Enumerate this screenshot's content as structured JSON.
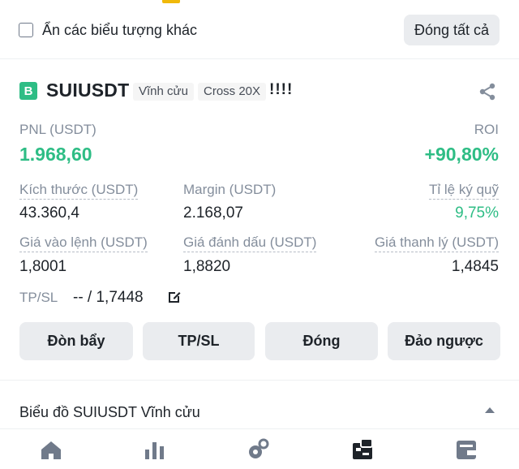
{
  "filter": {
    "hide_label": "Ẩn các biểu tượng khác",
    "close_all_label": "Đóng tất cả"
  },
  "position": {
    "badge": "B",
    "symbol": "SUIUSDT",
    "type_tag": "Vĩnh cửu",
    "margin_tag": "Cross 20X",
    "warning": "!!!!",
    "pnl_label": "PNL (USDT)",
    "pnl_value": "1.968,60",
    "roi_label": "ROI",
    "roi_value": "+90,80%",
    "size_label": "Kích thước (USDT)",
    "size_value": "43.360,4",
    "margin_label": "Margin (USDT)",
    "margin_value": "2.168,07",
    "margin_ratio_label": "Tỉ lệ ký quỹ",
    "margin_ratio_value": "9,75%",
    "entry_label": "Giá vào lệnh (USDT)",
    "entry_value": "1,8001",
    "mark_label": "Giá đánh dấu (USDT)",
    "mark_value": "1,8820",
    "liq_label": "Giá thanh lý (USDT)",
    "liq_value": "1,4845",
    "tpsl_label": "TP/SL",
    "tpsl_value": "-- / 1,7448"
  },
  "actions": {
    "leverage": "Đòn bẩy",
    "tpsl": "TP/SL",
    "close": "Đóng",
    "reverse": "Đảo ngược"
  },
  "chart": {
    "label": "Biểu đồ SUIUSDT Vĩnh cửu"
  },
  "colors": {
    "green": "#2ebd85",
    "accent": "#f0b90b",
    "button_bg": "#eaecef"
  },
  "nav": {
    "icons": [
      "home-icon",
      "markets-icon",
      "trade-icon",
      "futures-icon",
      "wallet-icon"
    ],
    "active": "futures-icon"
  }
}
